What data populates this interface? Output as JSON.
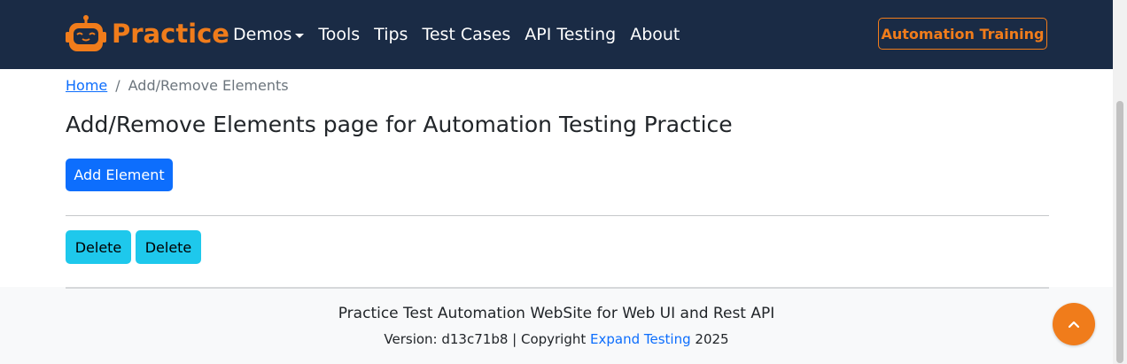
{
  "navbar": {
    "brand": "Practice",
    "links": [
      {
        "label": "Demos",
        "dropdown": true
      },
      {
        "label": "Tools"
      },
      {
        "label": "Tips"
      },
      {
        "label": "Test Cases"
      },
      {
        "label": "API Testing"
      },
      {
        "label": "About"
      }
    ],
    "cta_label": "Automation Training"
  },
  "breadcrumb": {
    "home": "Home",
    "separator": "/",
    "current": "Add/Remove Elements"
  },
  "main": {
    "title": "Add/Remove Elements page for Automation Testing Practice",
    "add_button": "Add Element",
    "delete_buttons": [
      "Delete",
      "Delete"
    ]
  },
  "footer": {
    "line1": "Practice Test Automation WebSite for Web UI and Rest API",
    "version_prefix": "Version: d13c71b8 | Copyright ",
    "company": "Expand Testing",
    "year": " 2025"
  },
  "colors": {
    "navbar_bg": "#1a2b45",
    "brand_orange": "#f07c1b",
    "primary": "#0d6efd",
    "info": "#1ec8ec",
    "footer_bg": "#f8f9fa"
  },
  "icons": {
    "brand": "robot-icon",
    "scroll_top": "chevron-up-icon"
  }
}
